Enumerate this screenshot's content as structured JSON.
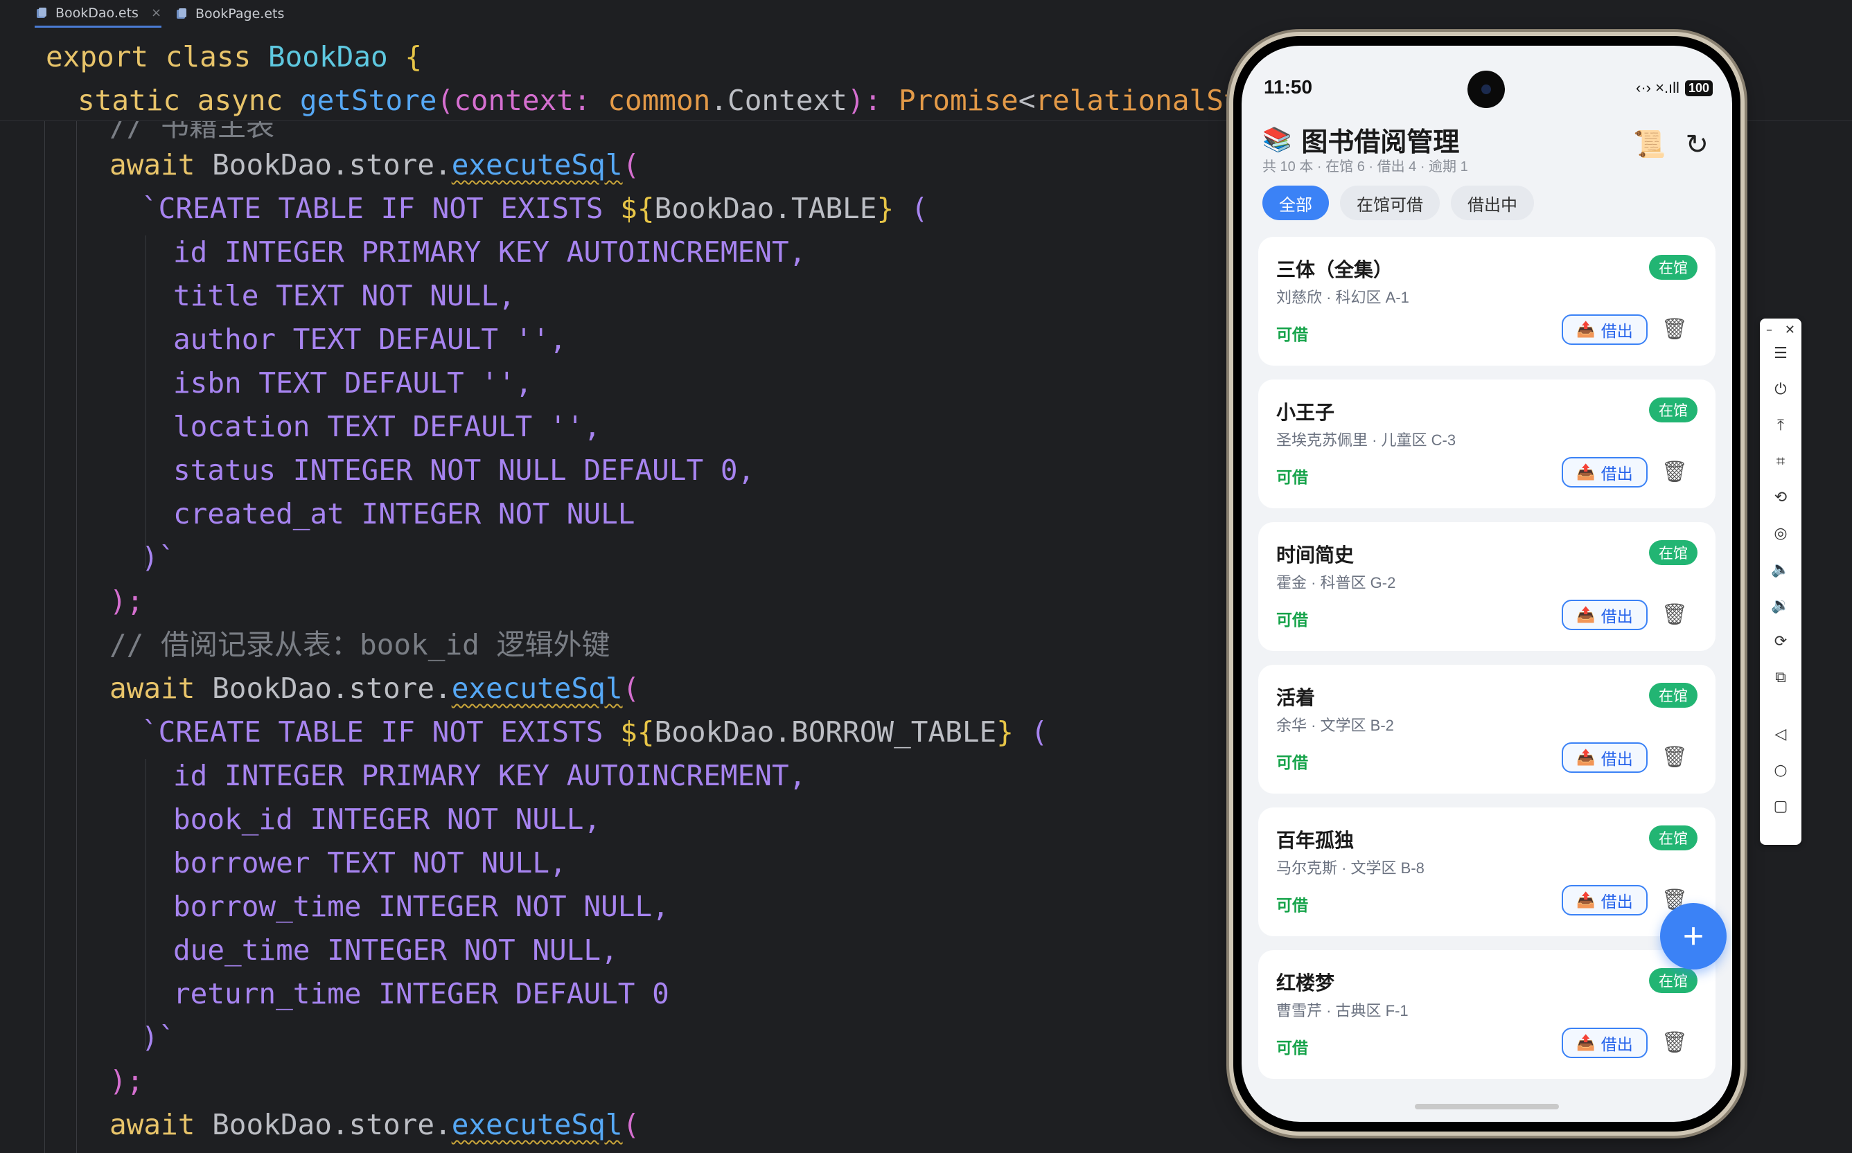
{
  "tabs": [
    {
      "label": "BookDao.ets",
      "active": true,
      "close": "×"
    },
    {
      "label": "BookPage.ets",
      "active": false
    }
  ],
  "code": {
    "sticky_1": {
      "export": "export",
      "class": "class",
      "name": "BookDao",
      "brace": "{"
    },
    "sticky_2": {
      "static": "static",
      "async": "async",
      "fn": "getStore",
      "params": "(context: ",
      "type1": "common",
      "dot": ".Context",
      "close": "): ",
      "ret": "Promise",
      "lt": "<",
      "ret2": "relationalStore.R"
    },
    "partial_comment": "// 书籍主表",
    "lines": [
      {
        "await": "await",
        "obj": " BookDao.store.",
        "fn": "executeSql",
        "paren": "("
      },
      {
        "tick": "`CREATE TABLE IF NOT EXISTS ",
        "d": "${",
        "expr": "BookDao.TABLE",
        "c": "}",
        "rest": " ("
      },
      "id INTEGER PRIMARY KEY AUTOINCREMENT,",
      "title TEXT NOT NULL,",
      "author TEXT DEFAULT '',",
      "isbn TEXT DEFAULT '',",
      "location TEXT DEFAULT '',",
      "status INTEGER NOT NULL DEFAULT 0,",
      "created_at INTEGER NOT NULL",
      ")`",
      ");",
      "// 借阅记录从表：book_id 逻辑外键",
      {
        "await": "await",
        "obj": " BookDao.store.",
        "fn": "executeSql",
        "paren": "("
      },
      {
        "tick": "`CREATE TABLE IF NOT EXISTS ",
        "d": "${",
        "expr": "BookDao.BORROW_TABLE",
        "c": "}",
        "rest": " ("
      },
      "id INTEGER PRIMARY KEY AUTOINCREMENT,",
      "book_id INTEGER NOT NULL,",
      "borrower TEXT NOT NULL,",
      "borrow_time INTEGER NOT NULL,",
      "due_time INTEGER NOT NULL,",
      "return_time INTEGER DEFAULT 0",
      ")`",
      ");",
      {
        "await": "await",
        "obj": " BookDao.store.",
        "fn": "executeSql",
        "paren": "("
      }
    ]
  },
  "phone": {
    "time": "11:50",
    "signal_icons": "‹·›  ×.ıll",
    "battery": "100",
    "title": "图书借阅管理",
    "summary": "共 10 本 · 在馆 6 · 借出 4 · 逾期 1",
    "filters": [
      "全部",
      "在馆可借",
      "借出中"
    ],
    "books": [
      {
        "title": "三体（全集）",
        "meta": "刘慈欣 · 科幻区 A-1",
        "status": "在馆",
        "avail": "可借",
        "action": "借出"
      },
      {
        "title": "小王子",
        "meta": "圣埃克苏佩里 · 儿童区 C-3",
        "status": "在馆",
        "avail": "可借",
        "action": "借出"
      },
      {
        "title": "时间简史",
        "meta": "霍金 · 科普区 G-2",
        "status": "在馆",
        "avail": "可借",
        "action": "借出"
      },
      {
        "title": "活着",
        "meta": "余华 · 文学区 B-2",
        "status": "在馆",
        "avail": "可借",
        "action": "借出"
      },
      {
        "title": "百年孤独",
        "meta": "马尔克斯 · 文学区 B-8",
        "status": "在馆",
        "avail": "可借",
        "action": "借出"
      },
      {
        "title": "红楼梦",
        "meta": "曹雪芹 · 古典区 F-1",
        "status": "在馆",
        "avail": "可借",
        "action": "借出"
      }
    ],
    "fab": "+"
  },
  "icons": {
    "logo": "books-icon",
    "scroll": "scroll-icon",
    "refresh": "refresh-icon",
    "lend": "outbox-tray-icon",
    "trash": "trash-icon"
  },
  "colors": {
    "accent": "#3b82f6",
    "badge": "#22b573",
    "avail": "#16a34a"
  }
}
